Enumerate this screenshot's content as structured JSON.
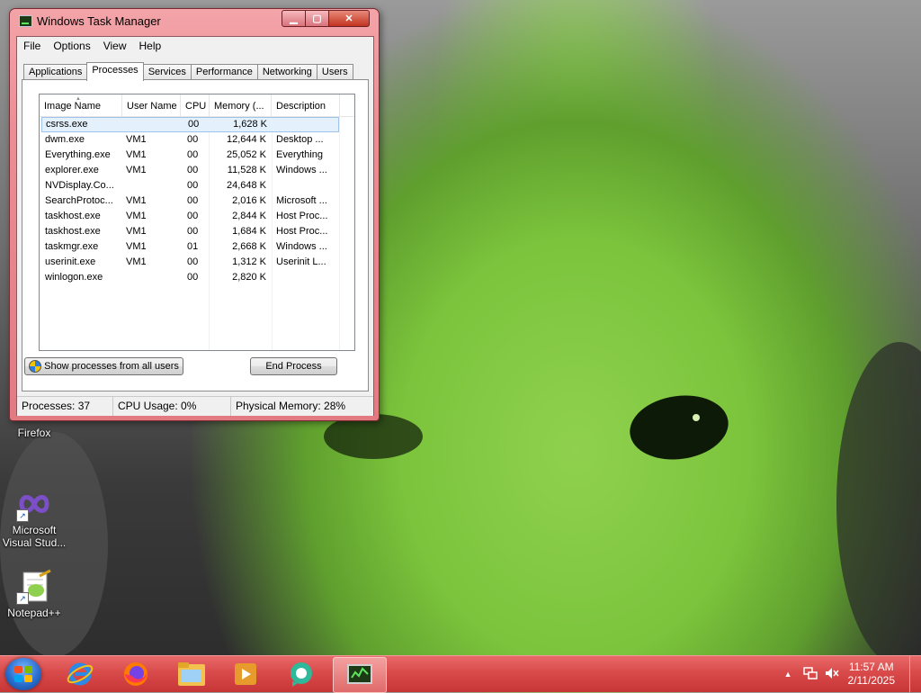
{
  "window": {
    "title": "Windows Task Manager",
    "menu": [
      "File",
      "Options",
      "View",
      "Help"
    ],
    "tabs": [
      "Applications",
      "Processes",
      "Services",
      "Performance",
      "Networking",
      "Users"
    ],
    "active_tab": "Processes",
    "columns": [
      "Image Name",
      "User Name",
      "CPU",
      "Memory (...",
      "Description"
    ],
    "processes": [
      {
        "name": "csrss.exe",
        "user": "",
        "cpu": "00",
        "memory": "1,628 K",
        "desc": ""
      },
      {
        "name": "dwm.exe",
        "user": "VM1",
        "cpu": "00",
        "memory": "12,644 K",
        "desc": "Desktop ..."
      },
      {
        "name": "Everything.exe",
        "user": "VM1",
        "cpu": "00",
        "memory": "25,052 K",
        "desc": "Everything"
      },
      {
        "name": "explorer.exe",
        "user": "VM1",
        "cpu": "00",
        "memory": "11,528 K",
        "desc": "Windows ..."
      },
      {
        "name": "NVDisplay.Co...",
        "user": "",
        "cpu": "00",
        "memory": "24,648 K",
        "desc": ""
      },
      {
        "name": "SearchProtoc...",
        "user": "VM1",
        "cpu": "00",
        "memory": "2,016 K",
        "desc": "Microsoft ..."
      },
      {
        "name": "taskhost.exe",
        "user": "VM1",
        "cpu": "00",
        "memory": "2,844 K",
        "desc": "Host Proc..."
      },
      {
        "name": "taskhost.exe",
        "user": "VM1",
        "cpu": "00",
        "memory": "1,684 K",
        "desc": "Host Proc..."
      },
      {
        "name": "taskmgr.exe",
        "user": "VM1",
        "cpu": "01",
        "memory": "2,668 K",
        "desc": "Windows ..."
      },
      {
        "name": "userinit.exe",
        "user": "VM1",
        "cpu": "00",
        "memory": "1,312 K",
        "desc": "Userinit L..."
      },
      {
        "name": "winlogon.exe",
        "user": "",
        "cpu": "00",
        "memory": "2,820 K",
        "desc": ""
      }
    ],
    "show_all_label": "Show processes from all users",
    "end_process_label": "End Process",
    "status": {
      "processes": "Processes: 37",
      "cpu": "CPU Usage: 0%",
      "memory": "Physical Memory: 28%"
    }
  },
  "desktop": {
    "icons": [
      {
        "label": "Firefox",
        "icon": "firefox-icon"
      },
      {
        "label": "Microsoft Visual Stud...",
        "icon": "visual-studio-icon"
      },
      {
        "label": "Notepad++",
        "icon": "notepad-plus-plus-icon"
      }
    ]
  },
  "taskbar": {
    "pinned": [
      "internet-explorer-icon",
      "firefox-icon",
      "file-explorer-icon",
      "media-player-icon",
      "chat-app-icon",
      "task-manager-icon"
    ],
    "clock_time": "11:57 AM",
    "clock_date": "2/11/2025",
    "colors": {
      "taskbar": "#d94a4a",
      "window_frame": "#ec8d94"
    }
  }
}
